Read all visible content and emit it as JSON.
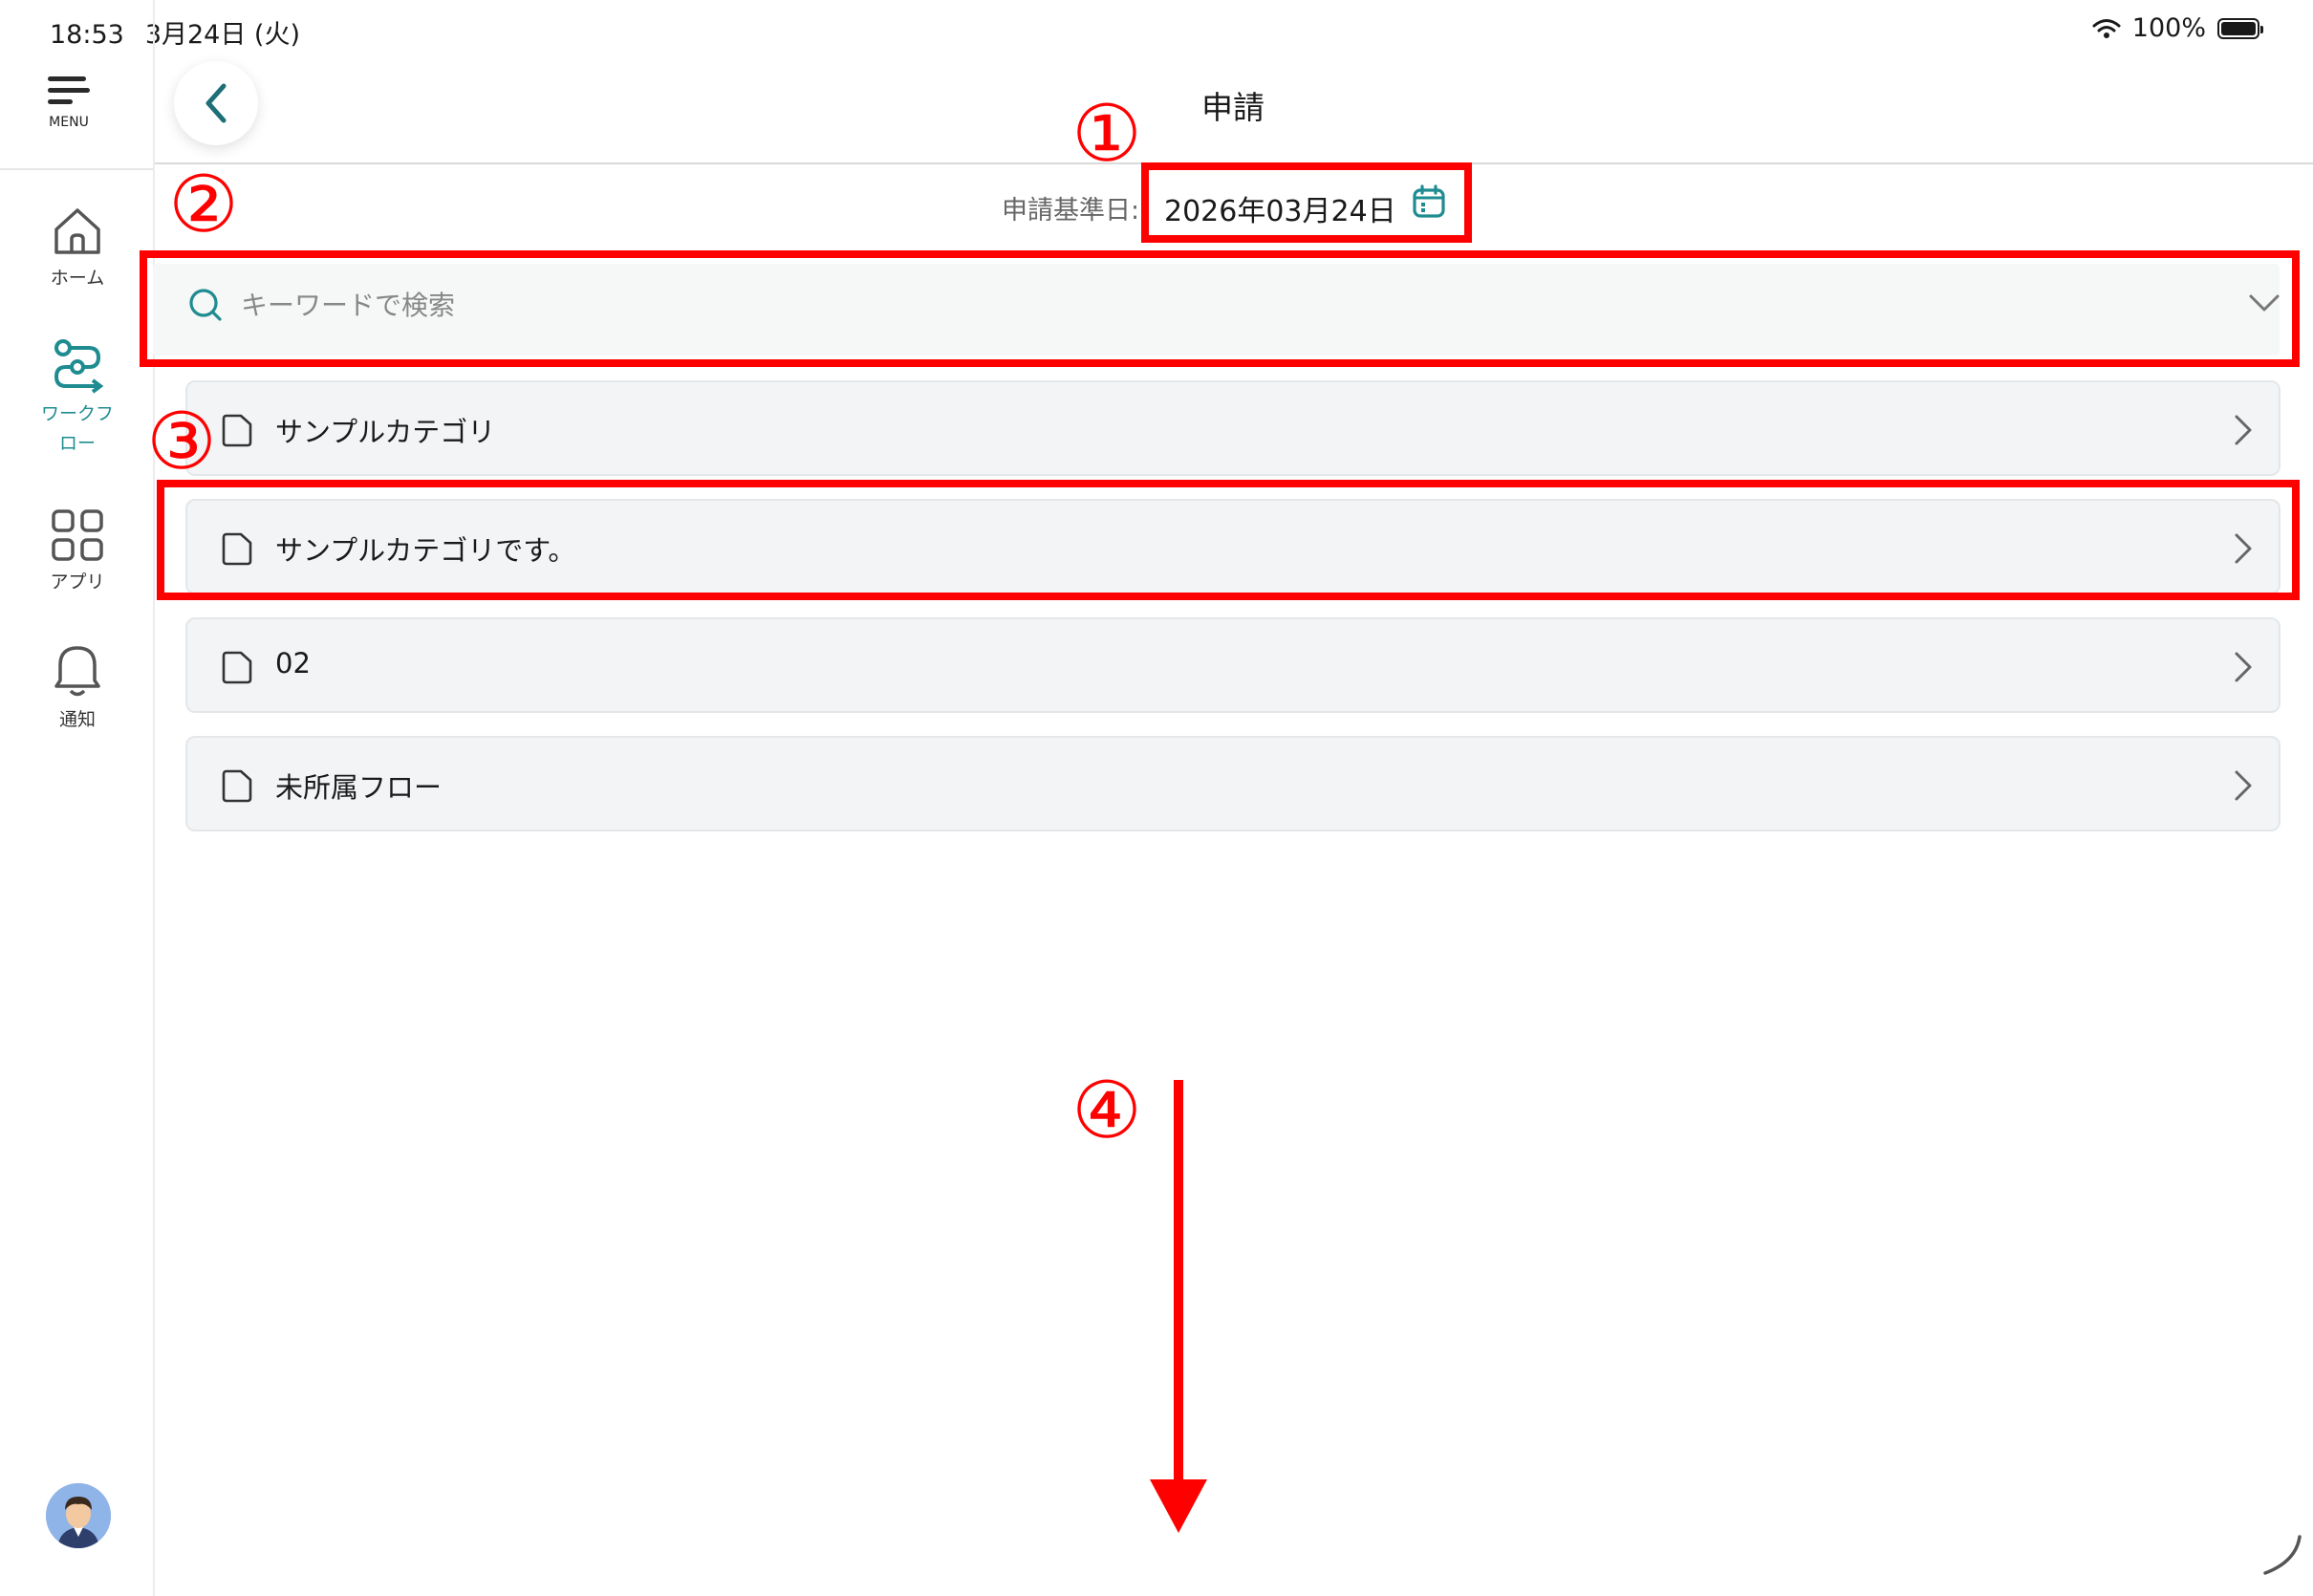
{
  "status_bar": {
    "time": "18:53",
    "date": "3月24日 (火)",
    "battery": "100%",
    "battery_level": 1.0
  },
  "sidebar": {
    "menu_label": "MENU",
    "items": [
      {
        "label": "ホーム",
        "icon": "home-icon",
        "active": false
      },
      {
        "label": "ワークフロー",
        "icon": "workflow-icon",
        "active": true
      },
      {
        "label": "アプリ",
        "icon": "apps-grid-icon",
        "active": false
      },
      {
        "label": "通知",
        "icon": "bell-icon",
        "active": false
      }
    ]
  },
  "header": {
    "title": "申請",
    "back_icon": "chevron-left-icon"
  },
  "date_row": {
    "label": "申請基準日:",
    "value": "2026年03月24日",
    "icon": "calendar-icon"
  },
  "search": {
    "placeholder": "キーワードで検索",
    "value": ""
  },
  "categories": [
    {
      "label": "サンプルカテゴリ"
    },
    {
      "label": "サンプルカテゴリです。"
    },
    {
      "label": "02"
    },
    {
      "label": "未所属フロー"
    }
  ],
  "annotations": {
    "n1": "①",
    "n2": "②",
    "n3": "③",
    "n4": "④"
  },
  "colors": {
    "accent": "#1e8c91",
    "annotation": "#ff0000",
    "row_bg": "#f2f4f6"
  }
}
